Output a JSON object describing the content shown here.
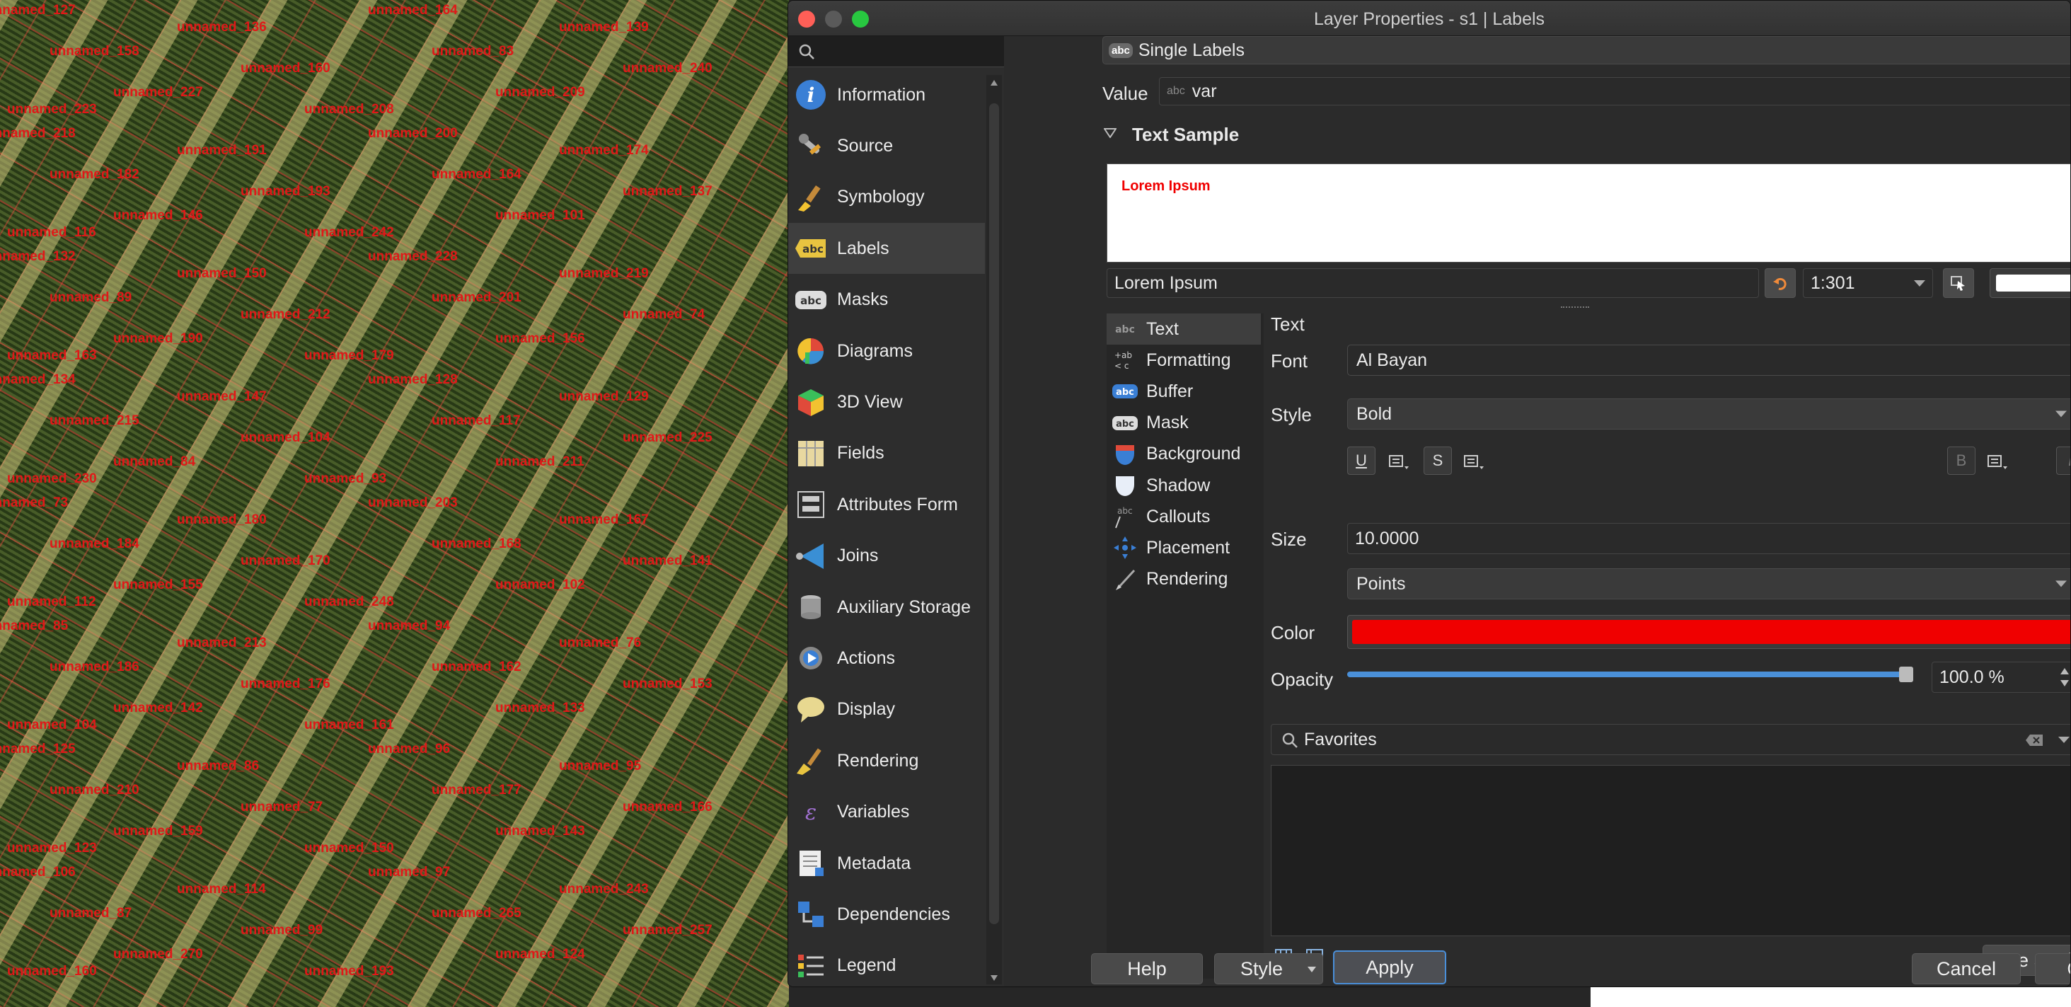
{
  "map": {
    "labels": [
      "unnamed_127",
      "unnamed_136",
      "unnamed_164",
      "unnamed_139",
      "unnamed_158",
      "unnamed_160",
      "unnamed_83",
      "unnamed_240",
      "unnamed_227",
      "unnamed_208",
      "unnamed_209",
      "unnamed_223",
      "unnamed_218",
      "unnamed_191",
      "unnamed_200",
      "unnamed_174",
      "unnamed_182",
      "unnamed_193",
      "unnamed_164",
      "unnamed_137",
      "unnamed_146",
      "unnamed_242",
      "unnamed_101",
      "unnamed_116",
      "unnamed_132",
      "unnamed_150",
      "unnamed_228",
      "unnamed_219",
      "unnamed_89",
      "unnamed_212",
      "unnamed_201",
      "unnamed_74",
      "unnamed_190",
      "unnamed_179",
      "unnamed_156",
      "unnamed_163",
      "unnamed_134",
      "unnamed_147",
      "unnamed_128",
      "unnamed_129",
      "unnamed_215",
      "unnamed_104",
      "unnamed_117",
      "unnamed_225",
      "unnamed_84",
      "unnamed_93",
      "unnamed_211",
      "unnamed_230",
      "unnamed_73",
      "unnamed_180",
      "unnamed_203",
      "unnamed_167",
      "unnamed_184",
      "unnamed_170",
      "unnamed_168",
      "unnamed_141",
      "unnamed_155",
      "unnamed_248",
      "unnamed_102",
      "unnamed_112",
      "unnamed_85",
      "unnamed_213",
      "unnamed_94",
      "unnamed_76",
      "unnamed_186",
      "unnamed_176",
      "unnamed_162",
      "unnamed_153",
      "unnamed_142",
      "unnamed_161",
      "unnamed_133",
      "unnamed_104",
      "unnamed_125",
      "unnamed_86",
      "unnamed_96",
      "unnamed_95",
      "unnamed_210",
      "unnamed_77",
      "unnamed_177",
      "unnamed_166",
      "unnamed_159",
      "unnamed_150",
      "unnamed_143",
      "unnamed_123",
      "unnamed_106",
      "unnamed_114",
      "unnamed_97",
      "unnamed_243",
      "unnamed_87",
      "unnamed_99",
      "unnamed_265",
      "unnamed_257",
      "unnamed_270",
      "unnamed_193",
      "unnamed_124",
      "unnamed_160"
    ]
  },
  "window": {
    "title": "Layer Properties - s1 | Labels"
  },
  "nav": {
    "search_placeholder": "",
    "items": [
      {
        "label": "Information",
        "icon": "info-icon"
      },
      {
        "label": "Source",
        "icon": "wrench-icon"
      },
      {
        "label": "Symbology",
        "icon": "paintbrush-icon"
      },
      {
        "label": "Labels",
        "icon": "labels-abc-icon"
      },
      {
        "label": "Masks",
        "icon": "mask-abc-icon"
      },
      {
        "label": "Diagrams",
        "icon": "diagram-icon"
      },
      {
        "label": "3D View",
        "icon": "cube-icon"
      },
      {
        "label": "Fields",
        "icon": "fields-icon"
      },
      {
        "label": "Attributes Form",
        "icon": "form-icon"
      },
      {
        "label": "Joins",
        "icon": "joins-icon"
      },
      {
        "label": "Auxiliary Storage",
        "icon": "database-icon"
      },
      {
        "label": "Actions",
        "icon": "actions-gear-icon"
      },
      {
        "label": "Display",
        "icon": "speech-bubble-icon"
      },
      {
        "label": "Rendering",
        "icon": "brush-icon"
      },
      {
        "label": "Variables",
        "icon": "variables-icon"
      },
      {
        "label": "Metadata",
        "icon": "metadata-icon"
      },
      {
        "label": "Dependencies",
        "icon": "dependencies-icon"
      },
      {
        "label": "Legend",
        "icon": "legend-icon"
      }
    ],
    "selected": "Labels"
  },
  "labeling": {
    "mode": "Single Labels",
    "value_label": "Value",
    "value": "var",
    "text_sample_header": "Text Sample",
    "sample_text": "Lorem Ipsum",
    "preview_input": "Lorem Ipsum",
    "scale": "1:301"
  },
  "tabs": {
    "items": [
      {
        "label": "Text",
        "icon": "abc-text-icon"
      },
      {
        "label": "Formatting",
        "icon": "formatting-icon"
      },
      {
        "label": "Buffer",
        "icon": "buffer-abc-icon"
      },
      {
        "label": "Mask",
        "icon": "mask-icon"
      },
      {
        "label": "Background",
        "icon": "background-shield-icon"
      },
      {
        "label": "Shadow",
        "icon": "shadow-icon"
      },
      {
        "label": "Callouts",
        "icon": "callouts-icon"
      },
      {
        "label": "Placement",
        "icon": "placement-icon"
      },
      {
        "label": "Rendering",
        "icon": "rendering-brush-icon"
      }
    ],
    "selected": "Text"
  },
  "text": {
    "section_title": "Text",
    "font_label": "Font",
    "font_value": "Al Bayan",
    "style_label": "Style",
    "style_value": "Bold",
    "underline": "U",
    "strike": "S",
    "bold": "B",
    "italic": "I",
    "size_label": "Size",
    "size_value": "10.0000",
    "unit_value": "Points",
    "color_label": "Color",
    "color_value": "#f00000",
    "opacity_label": "Opacity",
    "opacity_value": "100.0 %",
    "opacity_fraction": 1.0
  },
  "styles": {
    "search_value": "Favorites",
    "save_settings": "Save Settings..."
  },
  "footer": {
    "help": "Help",
    "style": "Style",
    "apply": "Apply",
    "cancel": "Cancel",
    "ok": "OK"
  }
}
